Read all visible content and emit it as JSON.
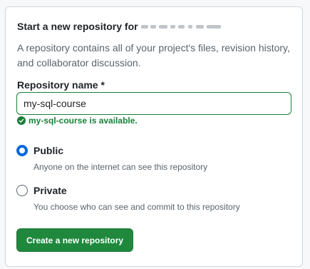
{
  "form": {
    "title": "Start a new repository for",
    "description": "A repository contains all of your project's files, revision history, and collaborator discussion.",
    "repo_name_label": "Repository name *",
    "repo_name_value": "my-sql-course",
    "availability_message": "my-sql-course is available.",
    "visibility": {
      "selected": "Public",
      "options": [
        {
          "label": "Public",
          "note": "Anyone on the internet can see this repository"
        },
        {
          "label": "Private",
          "note": "You choose who can see and commit to this repository"
        }
      ]
    },
    "submit_label": "Create a new repository"
  },
  "colors": {
    "success": "#1a7f37",
    "primary_button": "#1f883d",
    "radio_selected": "#0969da"
  },
  "icons": {
    "availability": "check-circle-fill-icon"
  }
}
